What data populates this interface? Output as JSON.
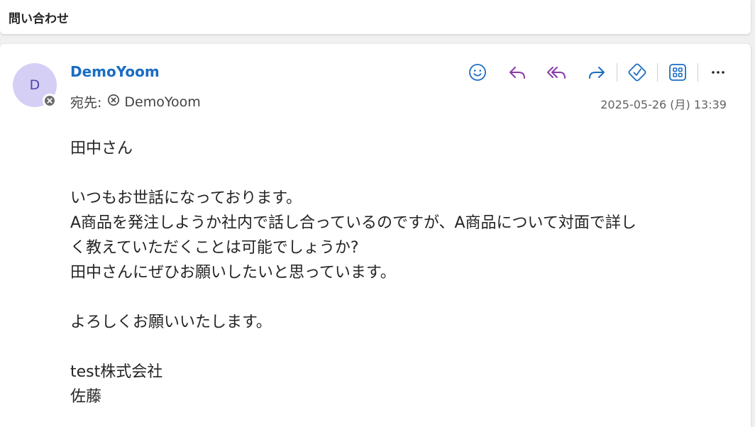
{
  "subject": {
    "title": "問い合わせ"
  },
  "message": {
    "avatar_initial": "D",
    "sender_name": "DemoYoom",
    "to_label": "宛先:",
    "recipient": "DemoYoom",
    "date": "2025-05-26 (月) 13:39",
    "body": {
      "greeting": "田中さん",
      "line1": "いつもお世話になっております。",
      "line2": "A商品を発注しようか社内で話し合っているのですが、A商品について対面で詳し",
      "line3": "く教えていただくことは可能でしょうか?",
      "line4": "田中さんにぜひお願いしたいと思っています。",
      "closing": "よろしくお願いいたします。",
      "company": "test株式会社",
      "name": "佐藤"
    }
  },
  "toolbar": {
    "icons": [
      "emoji-icon",
      "reply-icon",
      "reply-all-icon",
      "forward-icon",
      "tag-icon",
      "apps-icon",
      "more-icon"
    ]
  },
  "colors": {
    "accent": "#1a6dc2",
    "reply": "#8a3aa8",
    "avatar_bg": "#d5cff5"
  }
}
